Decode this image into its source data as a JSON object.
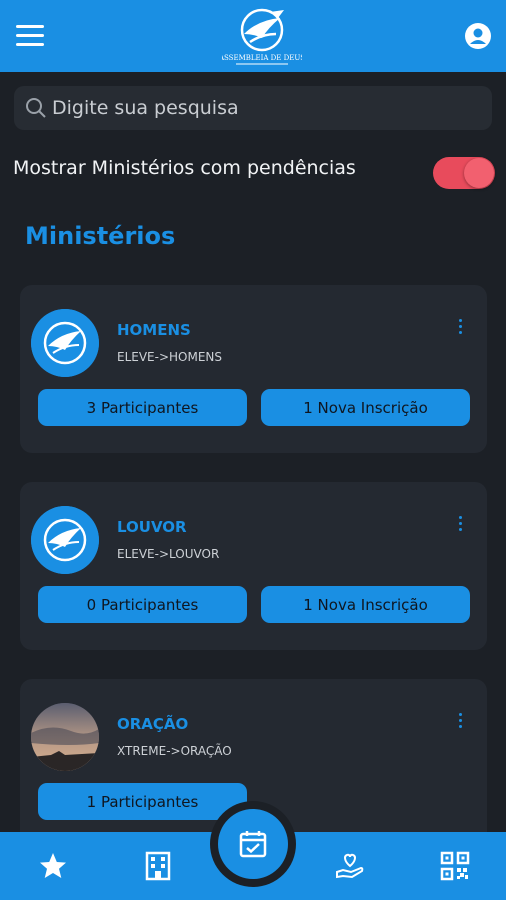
{
  "header": {
    "logo_text": "ASSEMBLEIA DE DEUS"
  },
  "search": {
    "placeholder": "Digite sua pesquisa",
    "value": ""
  },
  "filter": {
    "label": "Mostrar Ministérios com pendências",
    "enabled": true
  },
  "section": {
    "title": "Ministérios"
  },
  "ministries": [
    {
      "name": "HOMENS",
      "path": "ELEVE->HOMENS",
      "participants": "3 Participantes",
      "registrations": "1 Nova Inscrição"
    },
    {
      "name": "LOUVOR",
      "path": "ELEVE->LOUVOR",
      "participants": "0 Participantes",
      "registrations": "1 Nova Inscrição"
    },
    {
      "name": "ORAÇÃO",
      "path": "XTREME->ORAÇÃO",
      "participants": "1 Participantes",
      "registrations": ""
    }
  ],
  "nav": {
    "items": [
      "star-icon",
      "building-icon",
      "calendar-check-icon",
      "hand-heart-icon",
      "qr-code-icon"
    ],
    "active": "calendar-check-icon"
  },
  "colors": {
    "primary": "#1a8fe3",
    "background": "#1c2026",
    "card": "#242931",
    "toggle": "#e84b5c"
  }
}
